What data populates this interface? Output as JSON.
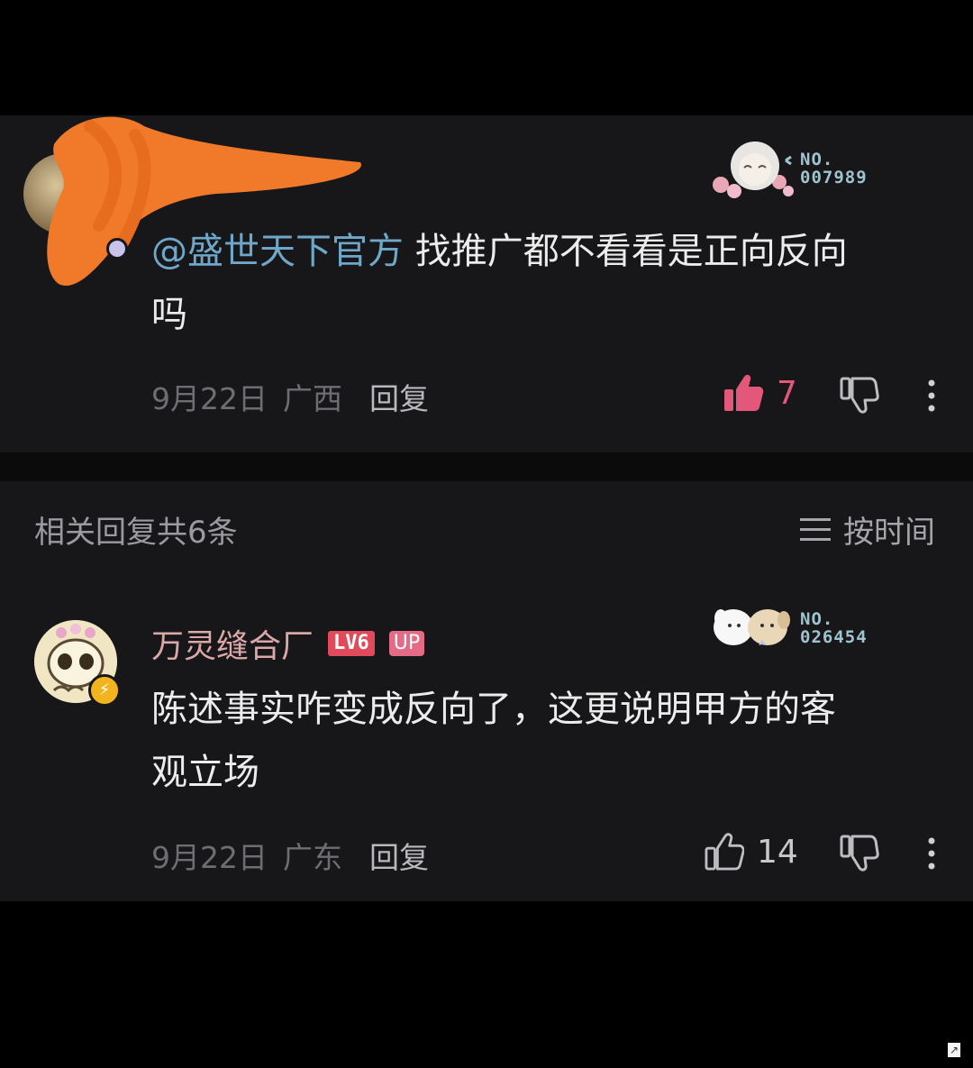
{
  "comment1": {
    "mention": "@盛世天下官方",
    "text_line1": " 找推广都不看看是正向反向",
    "text_line2": "吗",
    "date": "9月22日",
    "location": "广西",
    "reply_label": "回复",
    "like_count": "7",
    "fan_no_label": "NO.",
    "fan_no_value": "007989",
    "liked": true
  },
  "replies_header": {
    "title": "相关回复共6条",
    "sort_label": "按时间"
  },
  "comment2": {
    "username": "万灵缝合厂",
    "level": "LV6",
    "up_badge": "UP",
    "text_line1": "陈述事实咋变成反向了，这更说明甲方的客",
    "text_line2": "观立场",
    "date": "9月22日",
    "location": "广东",
    "reply_label": "回复",
    "like_count": "14",
    "fan_no_label": "NO.",
    "fan_no_value": "026454",
    "liked": false
  },
  "colors": {
    "background": "#000000",
    "card": "#17171a",
    "mention": "#6fa7c9",
    "like_active": "#e2577a",
    "username": "#dba7a7",
    "meta": "#6d6d72"
  },
  "icons": [
    "thumbs-up-icon",
    "thumbs-down-icon",
    "more-vertical-icon",
    "sort-lines-icon",
    "fan-card-icon",
    "vip-lightning-icon"
  ]
}
